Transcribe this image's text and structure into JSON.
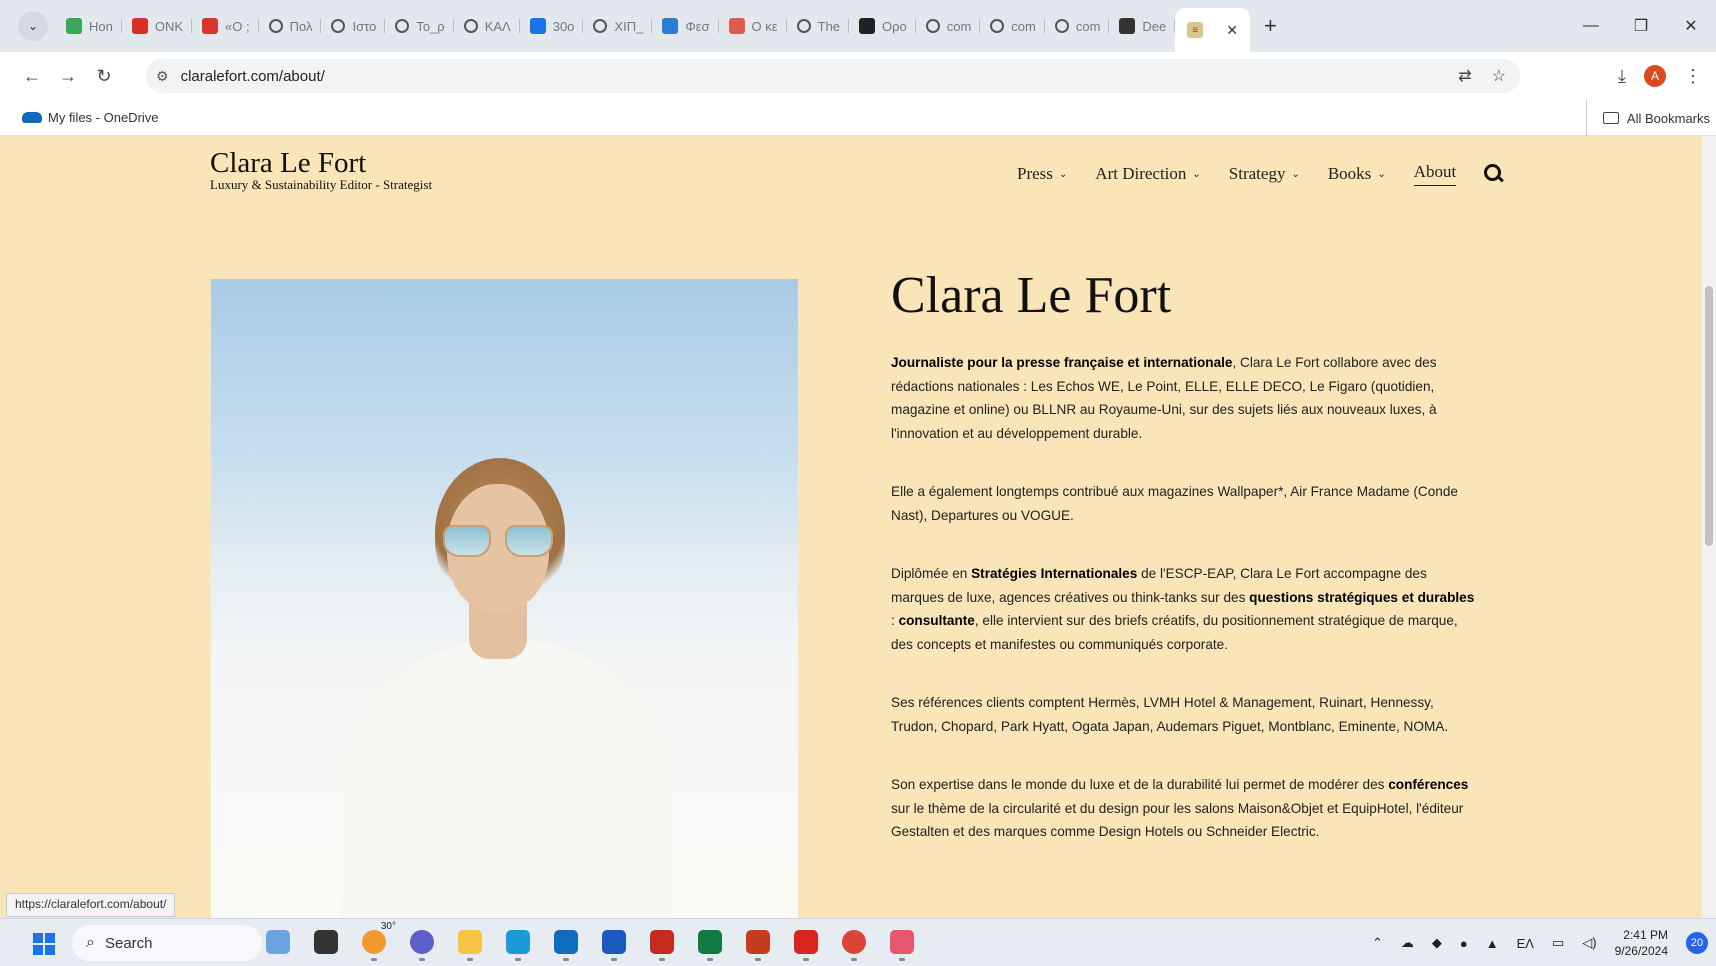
{
  "browser": {
    "tabs": [
      {
        "label": "Hon",
        "icon": "green-circle-icon",
        "color": "#3aa757"
      },
      {
        "label": "ONK",
        "icon": "gmail-icon",
        "color": "#d93025"
      },
      {
        "label": "«Ο ;",
        "icon": "red-square-icon",
        "color": "#d9362b"
      },
      {
        "label": "Πολ",
        "icon": "globe-icon",
        "color": "#555555"
      },
      {
        "label": "Ιστο",
        "icon": "globe-icon",
        "color": "#555555"
      },
      {
        "label": "Το_ρ",
        "icon": "globe-icon",
        "color": "#555555"
      },
      {
        "label": "ΚΑΛ",
        "icon": "globe-icon",
        "color": "#555555"
      },
      {
        "label": "30ο",
        "icon": "blue-square-icon",
        "color": "#1a73e8"
      },
      {
        "label": "ΧΙΠ_",
        "icon": "globe-icon",
        "color": "#555555"
      },
      {
        "label": "Φεσ",
        "icon": "blue-circle-icon",
        "color": "#2a7fd4"
      },
      {
        "label": "Ο κε",
        "icon": "red-badge-icon",
        "color": "#e05a4f"
      },
      {
        "label": "The",
        "icon": "globe-icon",
        "color": "#555555"
      },
      {
        "label": "Ορο",
        "icon": "c-letter-icon",
        "color": "#222222"
      },
      {
        "label": "com",
        "icon": "globe-icon",
        "color": "#555555"
      },
      {
        "label": "com",
        "icon": "globe-icon",
        "color": "#555555"
      },
      {
        "label": "com",
        "icon": "globe-icon",
        "color": "#555555"
      },
      {
        "label": "Dee",
        "icon": "deepseek-icon",
        "color": "#333333"
      }
    ],
    "active_tab_icon": "site-favicon",
    "url": "claralefort.com/about/",
    "bookmarks": {
      "item": "My files - OneDrive",
      "all": "All Bookmarks"
    },
    "profile_initial": "A",
    "status_url": "https://claralefort.com/about/"
  },
  "site": {
    "logo_title": "Clara Le Fort",
    "logo_subtitle": "Luxury & Sustainability Editor - Strategist",
    "nav": [
      {
        "label": "Press",
        "dropdown": true
      },
      {
        "label": "Art Direction",
        "dropdown": true
      },
      {
        "label": "Strategy",
        "dropdown": true
      },
      {
        "label": "Books",
        "dropdown": true
      },
      {
        "label": "About",
        "dropdown": false
      }
    ],
    "colors": {
      "background": "#f9e5b8",
      "text": "#111111"
    }
  },
  "about": {
    "heading": "Clara Le Fort",
    "p1_bold": "Journaliste pour la presse française et internationale",
    "p1_rest": ", Clara Le Fort collabore avec des rédactions nationales : Les Echos WE, Le Point, ELLE, ELLE DECO, Le Figaro (quotidien, magazine et online) ou BLLNR au Royaume-Uni, sur des sujets liés aux nouveaux luxes, à l'innovation et au développement durable.",
    "p2": "Elle a également longtemps contribué aux magazines Wallpaper*, Air France Madame (Conde Nast), Departures ou VOGUE.",
    "p3_a": "Diplômée en ",
    "p3_b1": "Stratégies Internationales",
    "p3_c": " de l'ESCP-EAP, Clara Le Fort accompagne des marques de luxe, agences créatives ou think-tanks sur des ",
    "p3_b2": "questions stratégiques et durables",
    "p3_d": " : ",
    "p3_b3": "consultante",
    "p3_e": ", elle intervient sur des briefs créatifs, du positionnement stratégique de marque, des concepts et manifestes ou communiqués corporate.",
    "p4": "Ses références clients comptent Hermès, LVMH Hotel & Management, Ruinart, Hennessy, Trudon, Chopard, Park Hyatt, Ogata Japan, Audemars Piguet, Montblanc, Eminente, NOMA.",
    "p5_a": "Son expertise dans le monde du luxe et de la durabilité lui permet de modérer des ",
    "p5_b": "conférences",
    "p5_c": " sur le thème de la circularité et du design pour les salons Maison&Objet et EquipHotel, l'éditeur Gestalten et des marques comme Design Hotels ou Schneider Electric."
  },
  "taskbar": {
    "search_placeholder": "Search",
    "weather_temp": "30°",
    "language": "EΛ",
    "time": "2:41 PM",
    "date": "9/26/2024",
    "notification_count": "20",
    "apps": [
      {
        "name": "widgets-icon",
        "color": "#6aa3e0"
      },
      {
        "name": "task-view-icon",
        "color": "#333333"
      },
      {
        "name": "weather-icon",
        "color": "#f29a2e"
      },
      {
        "name": "teams-icon",
        "color": "#5b5fc7"
      },
      {
        "name": "file-explorer-icon",
        "color": "#f6c343"
      },
      {
        "name": "edge-icon",
        "color": "#1e9bd7"
      },
      {
        "name": "outlook-icon",
        "color": "#0f6cbd"
      },
      {
        "name": "word-icon",
        "color": "#185abd"
      },
      {
        "name": "app-red-icon",
        "color": "#c42b1c"
      },
      {
        "name": "excel-icon",
        "color": "#107c41"
      },
      {
        "name": "powerpoint-icon",
        "color": "#c43e1c"
      },
      {
        "name": "acrobat-icon",
        "color": "#d7261e"
      },
      {
        "name": "chrome-icon",
        "color": "#db4437"
      },
      {
        "name": "snipping-tool-icon",
        "color": "#e5566f"
      }
    ]
  }
}
